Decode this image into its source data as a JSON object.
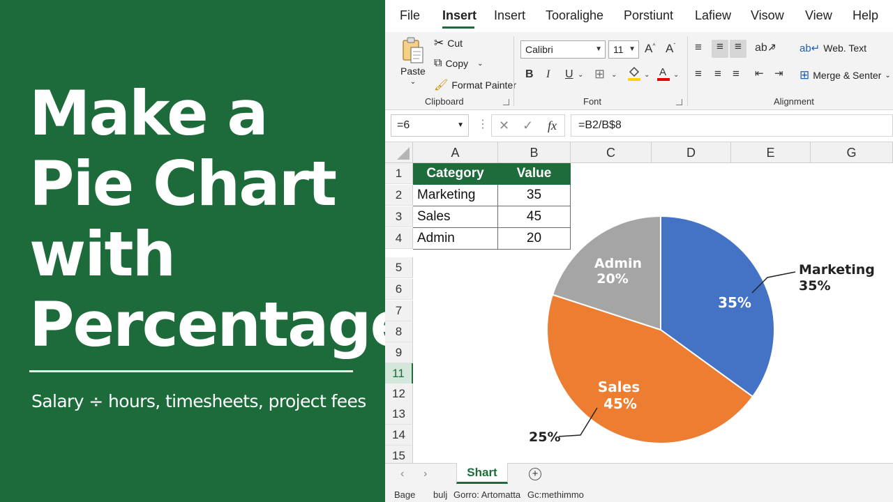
{
  "promo": {
    "headline_lines": [
      "Make a",
      "Pie Chart",
      "with",
      "Percentages"
    ],
    "subtitle": "Salary ÷ hours, timesheets, project fees",
    "background_color": "#1d6b3a"
  },
  "menu": {
    "items": [
      "File",
      "Insert",
      "Insert",
      "Tooralighe",
      "Porstiunt",
      "Lafiew",
      "Visow",
      "View",
      "Help"
    ],
    "active_index": 1
  },
  "ribbon": {
    "clipboard": {
      "paste": "Paste",
      "cut": "Cut",
      "copy": "Copy",
      "format_painter": "Format Painter",
      "label": "Clipboard"
    },
    "font": {
      "name": "Calibri",
      "size": "11",
      "grow": "A",
      "shrink": "A",
      "bold": "B",
      "italic": "I",
      "underline": "U",
      "label": "Font",
      "fill_color": "#ffd400",
      "font_color": "#e00000"
    },
    "alignment": {
      "wrap_text": "Web. Text",
      "merge_center": "Merge & Senter",
      "label": "Alignment"
    }
  },
  "formula_bar": {
    "name_box": "=6",
    "fx": "fx",
    "formula": "=B2/B$8"
  },
  "sheet": {
    "columns": [
      "A",
      "B",
      "C",
      "D",
      "E",
      "G"
    ],
    "rows": [
      "1",
      "2",
      "3",
      "4",
      "5",
      "6",
      "7",
      "8",
      "9",
      "11",
      "12",
      "13",
      "14",
      "15"
    ],
    "selected_row": "11",
    "header": [
      "Category",
      "Value"
    ],
    "data": [
      [
        "Marketing",
        "35"
      ],
      [
        "Sales",
        "45"
      ],
      [
        "Admin",
        "20"
      ]
    ]
  },
  "chart_data": {
    "type": "pie",
    "categories": [
      "Marketing",
      "Sales",
      "Admin"
    ],
    "values": [
      35,
      45,
      20
    ],
    "colors": [
      "#4472c4",
      "#ed7d31",
      "#a5a5a5"
    ],
    "labels": {
      "marketing_inside": "35%",
      "marketing_callout_name": "Marketing",
      "marketing_callout_pct": "35%",
      "sales_name": "Sales",
      "sales_pct": "45%",
      "sales_callout": "25%",
      "admin_name": "Admin",
      "admin_pct": "20%"
    }
  },
  "tabs": {
    "sheet_name": "Shart",
    "prev": "‹",
    "next": "›",
    "add": "+"
  },
  "status_bar": {
    "items": [
      "Bage",
      "bulj",
      "Gorro: Artomatta",
      "Gc:methimmo"
    ]
  }
}
